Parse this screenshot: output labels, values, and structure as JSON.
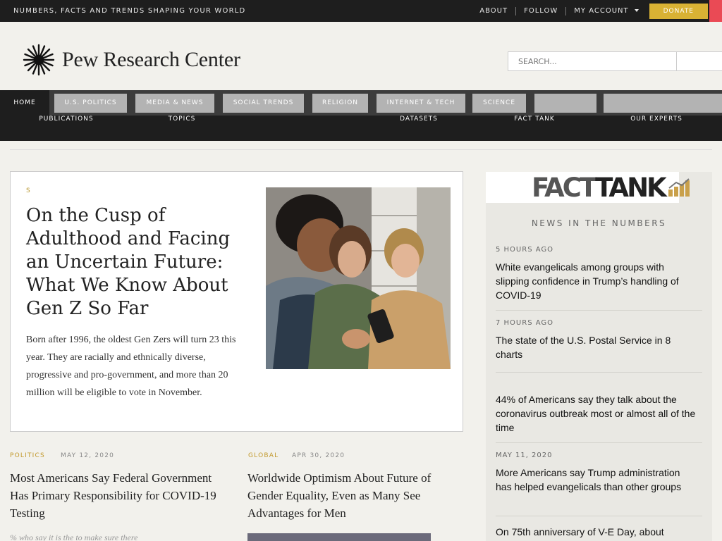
{
  "topbar": {
    "tagline": "NUMBERS, FACTS AND TRENDS SHAPING YOUR WORLD",
    "links": [
      "ABOUT",
      "FOLLOW",
      "MY ACCOUNT"
    ],
    "donate": "DONATE"
  },
  "header": {
    "brand": "Pew Research Center",
    "search_placeholder": "SEARCH..."
  },
  "nav": {
    "main": [
      "HOME",
      "U.S. POLITICS",
      "MEDIA & NEWS",
      "SOCIAL TRENDS",
      "RELIGION",
      "INTERNET & TECH",
      "SCIENCE"
    ],
    "sub": [
      "PUBLICATIONS",
      "TOPICS",
      "DATASETS",
      "FACT TANK",
      "OUR EXPERTS"
    ]
  },
  "feature": {
    "kicker": "S",
    "title": "On the Cusp of Adulthood and Facing an Uncertain Future: What We Know About Gen Z So Far",
    "description": "Born after 1996, the oldest Gen Zers will turn 23 this year. They are racially and ethnically diverse, progressive and pro-government, and more than 20 million will be eligible to vote in November."
  },
  "stories": [
    {
      "topic": "POLITICS",
      "date": "MAY 12, 2020",
      "title": "Most Americans Say Federal Government Has Primary Responsibility for COVID-19 Testing",
      "description": "% who say it is the          to make sure there"
    },
    {
      "topic": "GLOBAL",
      "date": "APR 30, 2020",
      "title": "Worldwide Optimism About Future of Gender Equality, Even as Many See Advantages for Men"
    }
  ],
  "sidebar": {
    "logo_part1": "FACT",
    "logo_part2": "TANK",
    "subtitle": "NEWS IN THE NUMBERS",
    "items": [
      {
        "time": "5 HOURS AGO",
        "text": "White evangelicals among groups with slipping confidence in Trump’s handling of COVID-19"
      },
      {
        "time": "7 HOURS AGO",
        "text": "The state of the U.S. Postal Service in 8 charts"
      },
      {
        "time": "",
        "text": "44% of Americans say they talk about the coronavirus outbreak most or almost all of the time"
      },
      {
        "time": "MAY 11, 2020",
        "text": "More Americans say Trump administration has helped evangelicals than other groups"
      },
      {
        "time": "",
        "text": "On 75th anniversary of V-E Day, about"
      }
    ]
  },
  "colors": {
    "gold": "#c39a2e",
    "dark": "#1e1e1e",
    "nav_tab": "#b3b3b3",
    "donate": "#d9b234"
  },
  "icons": [
    "pew-sunburst-logo-icon",
    "caret-down-icon",
    "fact-tank-chart-icon"
  ]
}
